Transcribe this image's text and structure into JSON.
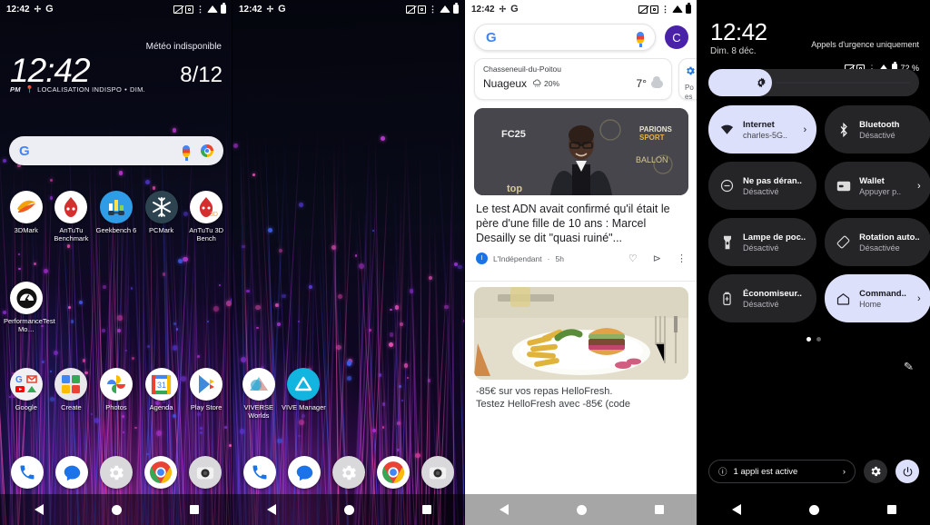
{
  "statusbar": {
    "time": "12:42",
    "icons": [
      "vibrate-off-icon",
      "screenshot-icon",
      "usb-icon",
      "wifi-icon",
      "battery-icon"
    ]
  },
  "panel1": {
    "weather_unavailable": "Météo indisponible",
    "clock": "12:42",
    "ampm": "PM",
    "date": "8/12",
    "location": "LOCALISATION INDISPO",
    "separator": "•",
    "day": "DIM.",
    "search_placeholder": "",
    "apps_row1": [
      {
        "label": "3DMark",
        "icon": "3dmark-icon"
      },
      {
        "label": "AnTuTu Benchmark",
        "icon": "antutu-icon"
      },
      {
        "label": "Geekbench 6",
        "icon": "geekbench-icon"
      },
      {
        "label": "PCMark",
        "icon": "pcmark-icon"
      },
      {
        "label": "AnTuTu 3D Bench",
        "icon": "antutu3d-icon"
      }
    ],
    "apps_row2": [
      {
        "label": "PerformanceTest Mo…",
        "icon": "performancetest-icon"
      }
    ],
    "apps_row3": [
      {
        "label": "Google",
        "icon": "google-folder-icon"
      },
      {
        "label": "Create",
        "icon": "create-folder-icon"
      },
      {
        "label": "Photos",
        "icon": "photos-icon"
      },
      {
        "label": "Agenda",
        "icon": "calendar-icon"
      },
      {
        "label": "Play Store",
        "icon": "play-store-icon"
      }
    ],
    "dock": [
      {
        "label": "Téléphone",
        "icon": "phone-icon"
      },
      {
        "label": "Messages",
        "icon": "messages-icon"
      },
      {
        "label": "Paramètres",
        "icon": "settings-gear-icon"
      },
      {
        "label": "Chrome",
        "icon": "chrome-icon"
      },
      {
        "label": "Appareil photo",
        "icon": "camera-icon"
      }
    ]
  },
  "panel2": {
    "apps": [
      {
        "label": "VIVERSE Worlds",
        "icon": "viverse-icon"
      },
      {
        "label": "VIVE Manager",
        "icon": "vive-icon"
      }
    ],
    "dock": [
      {
        "label": "Téléphone",
        "icon": "phone-icon"
      },
      {
        "label": "Messages",
        "icon": "messages-icon"
      },
      {
        "label": "Paramètres",
        "icon": "settings-gear-icon"
      },
      {
        "label": "Chrome",
        "icon": "chrome-icon"
      },
      {
        "label": "Appareil photo",
        "icon": "camera-icon"
      }
    ]
  },
  "panel3": {
    "search_placeholder": "",
    "avatar_initial": "C",
    "weather": {
      "city": "Chasseneuil-du-Poitou",
      "condition": "Nuageux",
      "precipitation": "20%",
      "temperature": "7°",
      "icon": "cloud-icon"
    },
    "side_card": {
      "line1": "Po",
      "line2": "es"
    },
    "article": {
      "title": "Le test ADN avait confirmé qu'il était le père d'une fille de 10 ans : Marcel Desailly se dit \"quasi ruiné\"...",
      "source": "L'Indépendant",
      "time": "5h",
      "source_initial": "I",
      "image_alt": "Marcel Desailly au Ballon d'Or",
      "actions": [
        "heart-icon",
        "share-icon",
        "more-vertical-icon"
      ]
    },
    "ad": {
      "line1": "-85€ sur vos repas HelloFresh.",
      "line2": "Testez HelloFresh avec -85€ (code",
      "image_alt": "Burger et frites"
    }
  },
  "panel4": {
    "clock": "12:42",
    "emergency": "Appels d'urgence uniquement",
    "date": "Dim. 8 déc.",
    "battery_percent": "72 %",
    "brightness_icon": "brightness-icon",
    "brightness_value": 30,
    "tiles": [
      {
        "title": "Internet",
        "sub": "charles-5G..",
        "icon": "wifi-icon",
        "on": true,
        "chevron": true
      },
      {
        "title": "Bluetooth",
        "sub": "Désactivé",
        "icon": "bluetooth-icon",
        "on": false,
        "chevron": false
      },
      {
        "title": "Ne pas déran..",
        "sub": "Désactivé",
        "icon": "do-not-disturb-icon",
        "on": false,
        "chevron": false
      },
      {
        "title": "Wallet",
        "sub": "Appuyer p..",
        "icon": "wallet-icon",
        "on": false,
        "chevron": true
      },
      {
        "title": "Lampe de poc..",
        "sub": "Désactivé",
        "icon": "flashlight-icon",
        "on": false,
        "chevron": false
      },
      {
        "title": "Rotation auto..",
        "sub": "Désactivée",
        "icon": "auto-rotate-icon",
        "on": false,
        "chevron": false
      },
      {
        "title": "Économiseur..",
        "sub": "Désactivé",
        "icon": "battery-saver-icon",
        "on": false,
        "chevron": false
      },
      {
        "title": "Command..",
        "sub": "Home",
        "icon": "home-icon",
        "on": true,
        "chevron": true
      }
    ],
    "pages": {
      "count": 2,
      "active": 0
    },
    "edit_icon": "pencil-icon",
    "active_apps": "1 appli est active",
    "settings_icon": "gear-icon",
    "power_icon": "power-icon"
  },
  "colors": {
    "accent_on": "#dde0fa",
    "tile_off": "#252528",
    "google_blue": "#4285F4",
    "google_red": "#EA4335",
    "google_yellow": "#FBBC05",
    "google_green": "#34A853"
  }
}
